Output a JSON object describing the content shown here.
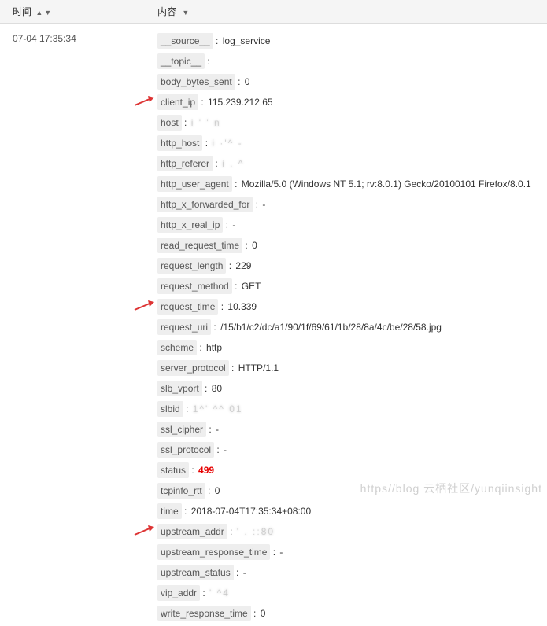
{
  "header": {
    "time_label": "时间",
    "content_label": "内容"
  },
  "row": {
    "timestamp": "07-04 17:35:34",
    "fields": [
      {
        "key": "__source__",
        "value": "log_service"
      },
      {
        "key": "__topic__",
        "value": ""
      },
      {
        "key": "body_bytes_sent",
        "value": "0"
      },
      {
        "key": "client_ip",
        "value": "115.239.212.65",
        "arrow": true
      },
      {
        "key": "host",
        "value": "i  ' ' n",
        "smudged": true
      },
      {
        "key": "http_host",
        "value": "i ·'^ -",
        "smudged": true
      },
      {
        "key": "http_referer",
        "value": "i    .   ^",
        "smudged": true
      },
      {
        "key": "http_user_agent",
        "value": "Mozilla/5.0 (Windows NT 5.1; rv:8.0.1) Gecko/20100101 Firefox/8.0.1"
      },
      {
        "key": "http_x_forwarded_for",
        "value": "-"
      },
      {
        "key": "http_x_real_ip",
        "value": "-"
      },
      {
        "key": "read_request_time",
        "value": "0"
      },
      {
        "key": "request_length",
        "value": "229"
      },
      {
        "key": "request_method",
        "value": "GET"
      },
      {
        "key": "request_time",
        "value": "10.339",
        "arrow": true
      },
      {
        "key": "request_uri",
        "value": "/15/b1/c2/dc/a1/90/1f/69/61/1b/28/8a/4c/be/28/58.jpg"
      },
      {
        "key": "scheme",
        "value": "http"
      },
      {
        "key": "server_protocol",
        "value": "HTTP/1.1"
      },
      {
        "key": "slb_vport",
        "value": "80"
      },
      {
        "key": "slbid",
        "value": "1^' ^^                                       01",
        "smudged": true
      },
      {
        "key": "ssl_cipher",
        "value": "-"
      },
      {
        "key": "ssl_protocol",
        "value": "-"
      },
      {
        "key": "status",
        "value": "499",
        "red": true
      },
      {
        "key": "tcpinfo_rtt",
        "value": "0"
      },
      {
        "key": "time",
        "value": "2018-07-04T17:35:34+08:00"
      },
      {
        "key": "upstream_addr",
        "value": "'    .        ::80",
        "smudged": true,
        "arrow": true
      },
      {
        "key": "upstream_response_time",
        "value": "-"
      },
      {
        "key": "upstream_status",
        "value": "-"
      },
      {
        "key": "vip_addr",
        "value": "'                ^4",
        "smudged": true
      },
      {
        "key": "write_response_time",
        "value": "0"
      }
    ]
  },
  "watermark": "https//blog 云栖社区/yunqiinsight"
}
